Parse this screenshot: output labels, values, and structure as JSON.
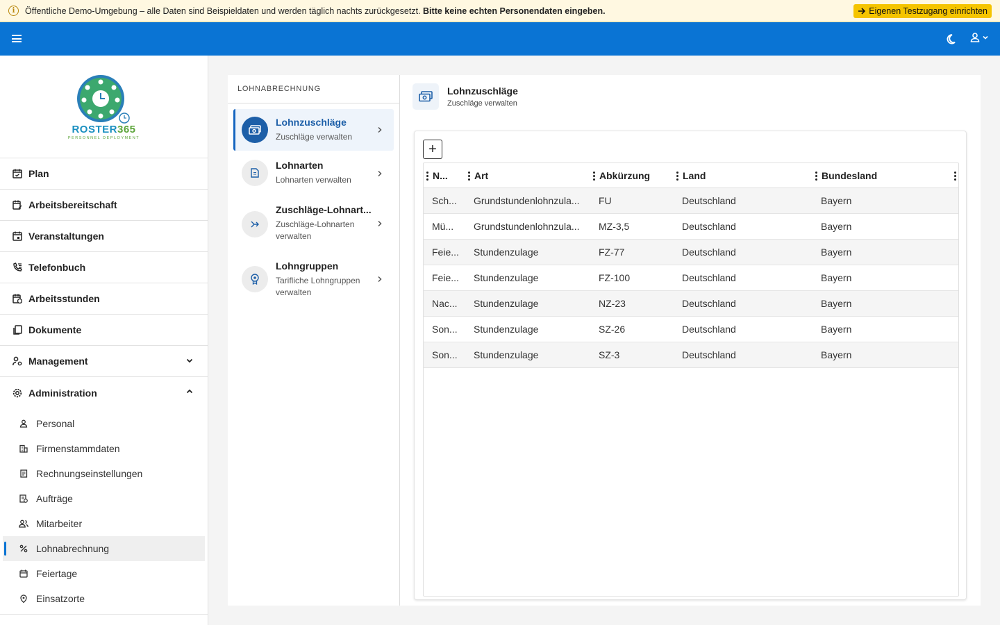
{
  "banner": {
    "message": "Öffentliche Demo-Umgebung – alle Daten sind Beispieldaten und werden täglich nachts zurückgesetzt.",
    "warning": "Bitte keine echten Personendaten eingeben.",
    "cta_label": "Eigenen Testzugang einrichten",
    "background": "#fff8e1",
    "cta_color": "#f5c400"
  },
  "topbar": {
    "color": "#0a74d4",
    "icons": [
      "menu-icon",
      "moon-icon",
      "user-icon",
      "chevron-down-icon"
    ]
  },
  "logo": {
    "brand_a": "ROSTER",
    "brand_b": "365",
    "tagline": "PERSONNEL DEPLOYMENT"
  },
  "sidebar": {
    "items": [
      {
        "label": "Plan",
        "icon": "calendar-check-icon"
      },
      {
        "label": "Arbeitsbereitschaft",
        "icon": "calendar-edit-icon"
      },
      {
        "label": "Veranstaltungen",
        "icon": "calendar-icon"
      },
      {
        "label": "Telefonbuch",
        "icon": "phone-book-icon"
      },
      {
        "label": "Arbeitsstunden",
        "icon": "calendar-clock-icon"
      },
      {
        "label": "Dokumente",
        "icon": "documents-icon"
      },
      {
        "label": "Management",
        "icon": "user-gear-icon",
        "expanded": false
      },
      {
        "label": "Administration",
        "icon": "gear-icon",
        "expanded": true
      }
    ],
    "admin_items": [
      {
        "label": "Personal",
        "icon": "person-icon"
      },
      {
        "label": "Firmenstammdaten",
        "icon": "building-icon"
      },
      {
        "label": "Rechnungseinstellungen",
        "icon": "invoice-icon"
      },
      {
        "label": "Aufträge",
        "icon": "order-icon"
      },
      {
        "label": "Mitarbeiter",
        "icon": "people-icon"
      },
      {
        "label": "Lohnabrechnung",
        "icon": "percent-icon",
        "active": true
      },
      {
        "label": "Feiertage",
        "icon": "holiday-icon"
      },
      {
        "label": "Einsatzorte",
        "icon": "location-icon"
      }
    ]
  },
  "subnav": {
    "heading": "LOHNABRECHNUNG",
    "items": [
      {
        "title": "Lohnzuschläge",
        "subtitle": "Zuschläge verwalten",
        "icon": "money-icon",
        "active": true
      },
      {
        "title": "Lohnarten",
        "subtitle": "Lohnarten verwalten",
        "icon": "wage-doc-icon"
      },
      {
        "title": "Zuschläge-Lohnart...",
        "subtitle": "Zuschläge-Lohnarten verwalten",
        "icon": "merge-arrows-icon"
      },
      {
        "title": "Lohngruppen",
        "subtitle": "Tarifliche Lohngruppen verwalten",
        "icon": "badge-icon"
      }
    ]
  },
  "content": {
    "title": "Lohnzuschläge",
    "subtitle": "Zuschläge verwalten",
    "add_label": "+"
  },
  "table": {
    "columns": [
      "N...",
      "Art",
      "Abkürzung",
      "Land",
      "Bundesland"
    ],
    "rows": [
      [
        "Sch...",
        "Grundstundenlohnzula...",
        "FU",
        "Deutschland",
        "Bayern"
      ],
      [
        "Mü...",
        "Grundstundenlohnzula...",
        "MZ-3,5",
        "Deutschland",
        "Bayern"
      ],
      [
        "Feie...",
        "Stundenzulage",
        "FZ-77",
        "Deutschland",
        "Bayern"
      ],
      [
        "Feie...",
        "Stundenzulage",
        "FZ-100",
        "Deutschland",
        "Bayern"
      ],
      [
        "Nac...",
        "Stundenzulage",
        "NZ-23",
        "Deutschland",
        "Bayern"
      ],
      [
        "Son...",
        "Stundenzulage",
        "SZ-26",
        "Deutschland",
        "Bayern"
      ],
      [
        "Son...",
        "Stundenzulage",
        "SZ-3",
        "Deutschland",
        "Bayern"
      ]
    ]
  }
}
